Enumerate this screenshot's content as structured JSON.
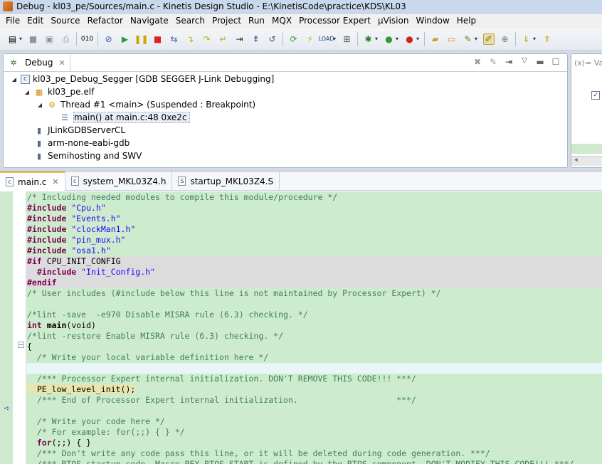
{
  "window": {
    "title": "Debug - kl03_pe/Sources/main.c - Kinetis Design Studio - E:\\KinetisCode\\practice\\KDS\\KL03"
  },
  "menu": [
    "File",
    "Edit",
    "Source",
    "Refactor",
    "Navigate",
    "Search",
    "Project",
    "Run",
    "MQX",
    "Processor Expert",
    "µVision",
    "Window",
    "Help"
  ],
  "toolbar": {
    "icons": [
      "new-icon",
      "save-icon",
      "save-all-icon",
      "print-icon",
      "binary-icon",
      "skip-breakpoints-icon",
      "resume-icon",
      "suspend-icon",
      "terminate-icon",
      "disconnect-icon",
      "step-into-icon",
      "step-over-icon",
      "step-return-icon",
      "instruction-stepping-icon",
      "drop-to-frame-icon",
      "restart-icon",
      "flash-icon",
      "load-icon",
      "processor-expert-icon",
      "debug-icon",
      "run-icon",
      "external-tools-icon",
      "new-folder-icon",
      "open-folder-icon",
      "build-icon",
      "highlight-icon",
      "toggle-mark-icon",
      "next-annotation-icon",
      "prev-annotation-icon"
    ]
  },
  "debug_view": {
    "tab_label": "Debug",
    "tree": [
      {
        "label": "kl03_pe_Debug_Segger [GDB SEGGER J-Link Debugging]",
        "icon": "launch-config-icon",
        "indent": 0,
        "expanded": true
      },
      {
        "label": "kl03_pe.elf",
        "icon": "debug-target-icon",
        "indent": 1,
        "expanded": true
      },
      {
        "label": "Thread #1 <main> (Suspended : Breakpoint)",
        "icon": "thread-icon",
        "indent": 2,
        "expanded": true
      },
      {
        "label": "main() at main.c:48 0xe2c",
        "icon": "stack-frame-icon",
        "indent": 3,
        "expanded": null,
        "selected": true
      },
      {
        "label": "JLinkGDBServerCL",
        "icon": "process-icon",
        "indent": 1,
        "expanded": null
      },
      {
        "label": "arm-none-eabi-gdb",
        "icon": "process-icon",
        "indent": 1,
        "expanded": null
      },
      {
        "label": "Semihosting and SWV",
        "icon": "process-icon",
        "indent": 1,
        "expanded": null
      }
    ]
  },
  "variables_view": {
    "tab_label": "(x)= Vari"
  },
  "editor": {
    "tabs": [
      {
        "label": "main.c",
        "icon_letter": "c",
        "active": true
      },
      {
        "label": "system_MKL03Z4.h",
        "icon_letter": "c",
        "active": false
      },
      {
        "label": "startup_MKL03Z4.S",
        "icon_letter": "S",
        "active": false
      }
    ],
    "lines": [
      {
        "text": "/* Including needed modules to compile this module/procedure */",
        "style": "comment",
        "bg": "normal"
      },
      {
        "pre": "#include ",
        "str": "\"Cpu.h\"",
        "style": "include",
        "bg": "normal"
      },
      {
        "pre": "#include ",
        "str": "\"Events.h\"",
        "style": "include",
        "bg": "normal"
      },
      {
        "pre": "#include ",
        "str": "\"clockMan1.h\"",
        "style": "include",
        "bg": "normal"
      },
      {
        "pre": "#include ",
        "str": "\"pin_mux.h\"",
        "style": "include",
        "bg": "normal"
      },
      {
        "pre": "#include ",
        "str": "\"osa1.h\"",
        "style": "include",
        "bg": "normal"
      },
      {
        "pre": "#if ",
        "text": "CPU_INIT_CONFIG",
        "style": "ifdirective",
        "bg": "gray"
      },
      {
        "pre": "  #include ",
        "str": "\"Init_Config.h\"",
        "style": "include",
        "bg": "gray"
      },
      {
        "text": "#endif",
        "style": "pp",
        "bg": "gray"
      },
      {
        "text": "/* User includes (#include below this line is not maintained by Processor Expert) */",
        "style": "comment",
        "bg": "normal"
      },
      {
        "text": "",
        "style": "plain",
        "bg": "normal"
      },
      {
        "text": "/*lint -save  -e970 Disable MISRA rule (6.3) checking. */",
        "style": "comment",
        "bg": "normal"
      },
      {
        "kw": "int ",
        "text": "main",
        "post": "(void)",
        "style": "signature",
        "bg": "normal"
      },
      {
        "text": "/*lint -restore Enable MISRA rule (6.3) checking. */",
        "style": "comment",
        "bg": "normal"
      },
      {
        "text": "{",
        "style": "plain",
        "bg": "normal"
      },
      {
        "text": "  /* Write your local variable definition here */",
        "style": "comment",
        "bg": "normal"
      },
      {
        "text": "",
        "style": "plain",
        "bg": "current"
      },
      {
        "text": "  /*** Processor Expert internal initialization. DON'T REMOVE THIS CODE!!! ***/",
        "style": "comment",
        "bg": "normal"
      },
      {
        "text": "  PE_low_level_init();",
        "style": "exec",
        "bg": "normal"
      },
      {
        "text": "  /*** End of Processor Expert internal initialization.                    ***/",
        "style": "comment",
        "bg": "normal"
      },
      {
        "text": "",
        "style": "plain",
        "bg": "normal"
      },
      {
        "text": "  /* Write your code here */",
        "style": "comment",
        "bg": "normal"
      },
      {
        "text": "  /* For example: for(;;) { } */",
        "style": "comment",
        "bg": "normal"
      },
      {
        "kw": "  for",
        "post": "(;;) { }",
        "style": "kwline",
        "bg": "normal"
      },
      {
        "text": "  /*** Don't write any code pass this line, or it will be deleted during code generation. ***/",
        "style": "comment",
        "bg": "normal"
      },
      {
        "text": "  /*** RTOS startup code. Macro PEX_RTOS_START is defined by the RTOS component. DON'T MODIFY THIS CODE!!! ***/",
        "style": "comment",
        "bg": "normal"
      }
    ]
  }
}
